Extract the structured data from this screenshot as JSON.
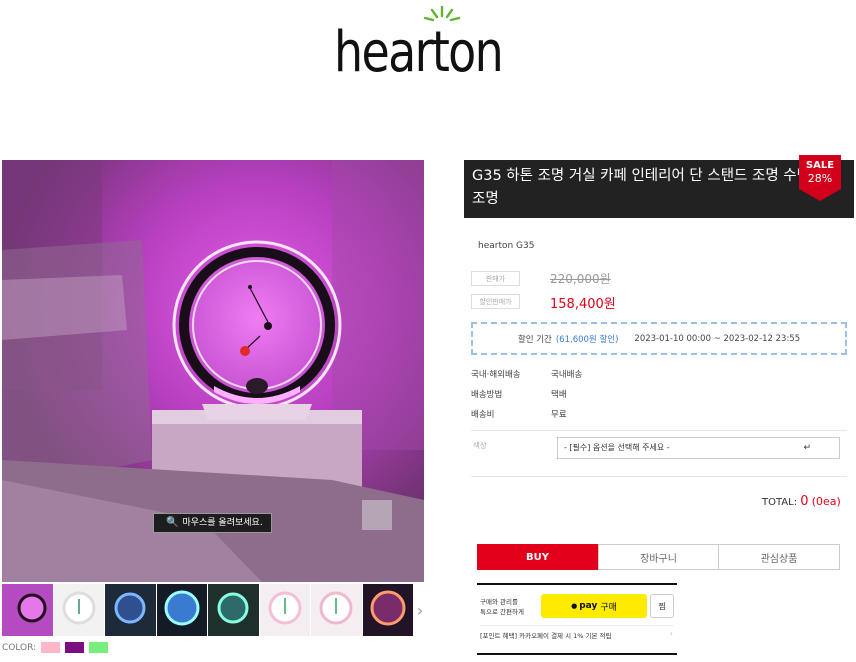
{
  "brand": {
    "logo_text": "hearton"
  },
  "gallery": {
    "zoom_hint": "마우스를 올려보세요.",
    "thumbnail_count": 8,
    "next_label": "›",
    "color_label": "COLOR:",
    "colors": [
      "#ffb6c8",
      "#7b0f82",
      "#7aee7a"
    ]
  },
  "product": {
    "title": "G35 하톤 조명 거실 카페 인테리어 단 스탠드 조명 수면 명상 조명",
    "sale_badge": {
      "top": "SALE",
      "pct": "28%"
    },
    "sku": "hearton G35",
    "price_label": "판매가",
    "price_original": "220,000원",
    "sale_price_label": "할인판매가",
    "price_sale": "158,400원",
    "discount": {
      "label": "할인 기간",
      "amount": "(61,600원 할인)",
      "period": "2023-01-10 00:00 ~ 2023-02-12 23:55"
    },
    "info": [
      {
        "key": "국내·해외배송",
        "value": "국내배송"
      },
      {
        "key": "배송방법",
        "value": "택배"
      },
      {
        "key": "배송비",
        "value": "무료"
      }
    ],
    "option": {
      "label": "색상",
      "selected": "- [필수] 옵션을 선택해 주세요 -",
      "arrow": "↵"
    },
    "total": {
      "label": "TOTAL:",
      "amount": "0",
      "qty": "(0ea)"
    },
    "buttons": {
      "buy": "BUY",
      "cart": "장바구니",
      "wish": "관심상품"
    },
    "kakaopay": {
      "desc_line1": "구매와 관리를",
      "desc_line2": "톡으로 간편하게",
      "pay_brand": "pay",
      "pay_action": "구매",
      "wish_label": "찜",
      "benefit": "[포인트 혜택] 카카오페이 결제 시 1% 기본 적립",
      "chevron": "›"
    }
  }
}
